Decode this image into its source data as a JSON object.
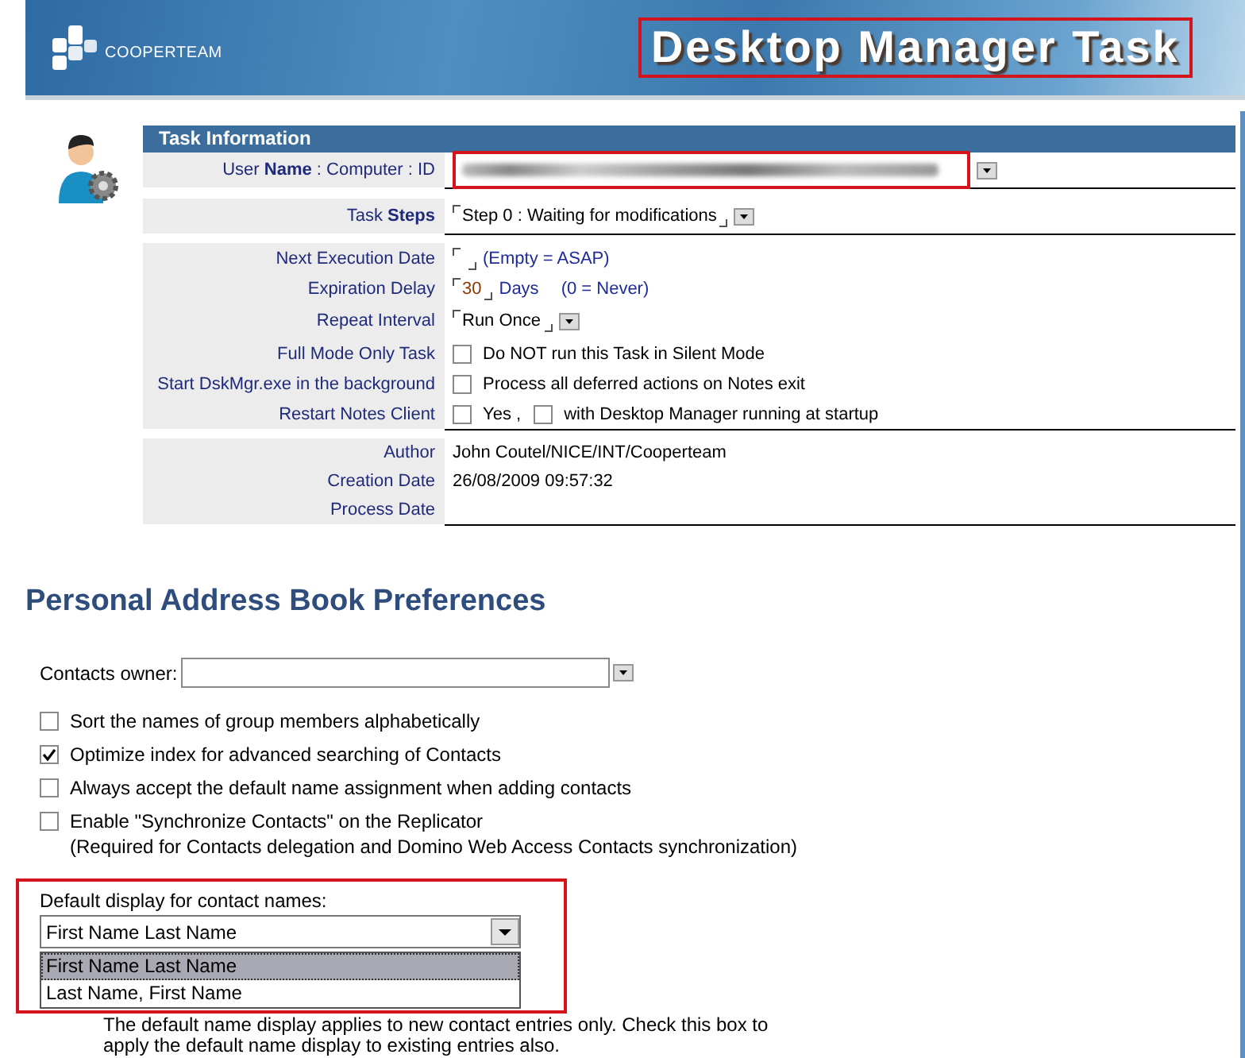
{
  "header": {
    "brand": "COOPERTEAM",
    "title": "Desktop Manager Task"
  },
  "task_panel": {
    "title": "Task Information",
    "sections": [
      {
        "rows": [
          {
            "label": "User **Name** : Computer : ID",
            "kind": "blurred"
          }
        ]
      },
      {
        "rows": [
          {
            "label": "Task **Steps**",
            "kind": "select",
            "value": "Step 0 : Waiting for modifications"
          }
        ]
      },
      {
        "rows": [
          {
            "label": "Next Execution Date",
            "kind": "input",
            "value": "",
            "notes": [
              "(Empty = ASAP)"
            ]
          },
          {
            "label": "Expiration Delay",
            "kind": "input",
            "value": "30",
            "notes": [
              "Days",
              "(0 = Never)"
            ]
          },
          {
            "label": "Repeat Interval",
            "kind": "select",
            "value": "Run Once"
          },
          {
            "label": "Full Mode Only Task",
            "kind": "checks",
            "checks": [
              {
                "label": "Do NOT run this Task in Silent Mode",
                "checked": false
              }
            ]
          },
          {
            "label": "Start DskMgr.exe in the background",
            "kind": "checks",
            "checks": [
              {
                "label": "Process all deferred actions on Notes exit",
                "checked": false
              }
            ]
          },
          {
            "label": "Restart Notes Client",
            "kind": "checks",
            "checks": [
              {
                "label": "Yes ,",
                "checked": false
              },
              {
                "label": "with Desktop Manager running at startup",
                "checked": false
              }
            ]
          }
        ]
      },
      {
        "rows": [
          {
            "label": "Author",
            "kind": "text",
            "value": "John Coutel/NICE/INT/Cooperteam"
          },
          {
            "label": "Creation Date",
            "kind": "text",
            "value": "26/08/2009 09:57:32"
          },
          {
            "label": "Process Date",
            "kind": "text",
            "value": ""
          }
        ]
      }
    ]
  },
  "preferences": {
    "title": "Personal Address Book Preferences",
    "owner_label": "Contacts owner:",
    "options": [
      {
        "label": "Sort the names of group members alphabetically",
        "checked": false
      },
      {
        "label": "Optimize index for advanced searching of Contacts",
        "checked": true
      },
      {
        "label": "Always accept the default name assignment when adding contacts",
        "checked": false
      },
      {
        "label": "Enable \"Synchronize Contacts\" on the Replicator",
        "checked": false,
        "note": "(Required for Contacts delegation and Domino Web Access Contacts synchronization)"
      }
    ],
    "display_label": "Default display for contact names:",
    "display_value": "First Name Last Name",
    "display_options": [
      {
        "label": "First Name Last Name",
        "selected": true
      },
      {
        "label": "Last Name, First Name",
        "selected": false
      }
    ],
    "display_note": [
      "The default name display applies to new contact entries only.  Check this box to",
      "apply the default name display to existing entries also."
    ]
  }
}
